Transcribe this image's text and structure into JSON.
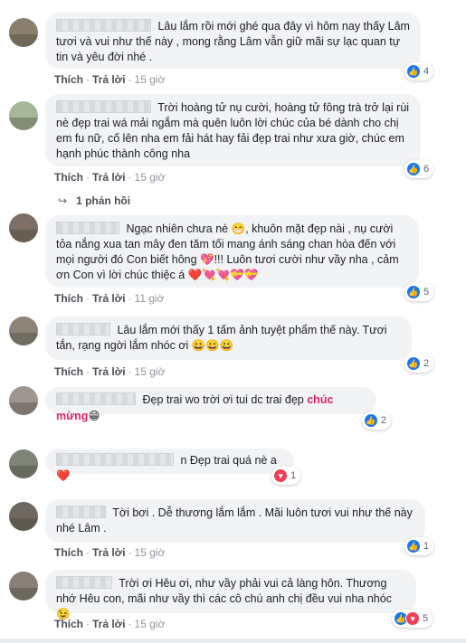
{
  "comments": [
    {
      "text": "Lâu lắm rồi mới ghé qua đây vì hôm nay thấy Lâm tươi và vui như thế này , mong rằng Lâm vẫn giữ mãi sự lạc quan tự tin và yêu đời nhé .",
      "like": "Thích",
      "reply": "Trả lời",
      "time": "15 giờ",
      "reaction_count": "4"
    },
    {
      "text": "Trời hoàng tử nụ cười, hoàng tử fông trà trở lại rùi nè đẹp trai wá mải ngắm mà quên luôn lời chúc của bé dành cho chị em fu nữ, cố lên nha em fải hát hay fải đẹp trai như xưa giờ, chúc em hạnh phúc thành công nha",
      "like": "Thích",
      "reply": "Trả lời",
      "time": "15 giờ",
      "reaction_count": "6",
      "replies_label": "1 phản hồi"
    },
    {
      "text": "Ngạc nhiên chưa nè 😁, khuôn mặt đẹp nài , nụ cười tỏa nắng xua tan mây đen tăm tối mang ánh sáng chan hòa đến với mọi người đó Con biết hông 💖!!! Luôn tươi cười như vầy nha , cảm ơn Con vì lời chúc thiệc á ❤️💘💘💝💝",
      "like": "Thích",
      "reply": "Trả lời",
      "time": "11 giờ",
      "reaction_count": "5"
    },
    {
      "text": "Lâu lắm mới thấy 1 tấm ảnh tuyệt phẩm thế này. Tươi tắn, rạng ngời lắm nhóc ơi 😀😀😀",
      "like": "Thích",
      "reply": "Trả lời",
      "time": "15 giờ",
      "reaction_count": "2"
    },
    {
      "text_before": "Đẹp trai wo trời ơi tui dc trai đẹp ",
      "text_highlight": "chúc mừng",
      "text_after": "😁",
      "reaction_count": "2"
    },
    {
      "text": "n Đẹp trai quá nè a ❤️",
      "reaction_count": "1"
    },
    {
      "text": "Tời bơi . Dễ thương lắm lắm . Mãi luôn tươi vui như thế này nhé Lâm .",
      "like": "Thích",
      "reply": "Trả lời",
      "time": "15 giờ",
      "reaction_count": "1"
    },
    {
      "text": "Trời ơi Hêu ơi, như vầy phải vui cả làng hôn. Thương nhớ Hêu con, mãi như vầy thì các cô chú anh chị đều vui nha nhóc 😉",
      "like": "Thích",
      "reply": "Trả lời",
      "time": "15 giờ",
      "reaction_count": "5"
    }
  ],
  "icons": {
    "like": "thumbs-up-icon",
    "love": "heart-icon",
    "reply_arrow": "reply-arrow-icon"
  },
  "colors": {
    "like": "#1877f2",
    "love": "#f33e58",
    "highlight": "#e0245e"
  }
}
